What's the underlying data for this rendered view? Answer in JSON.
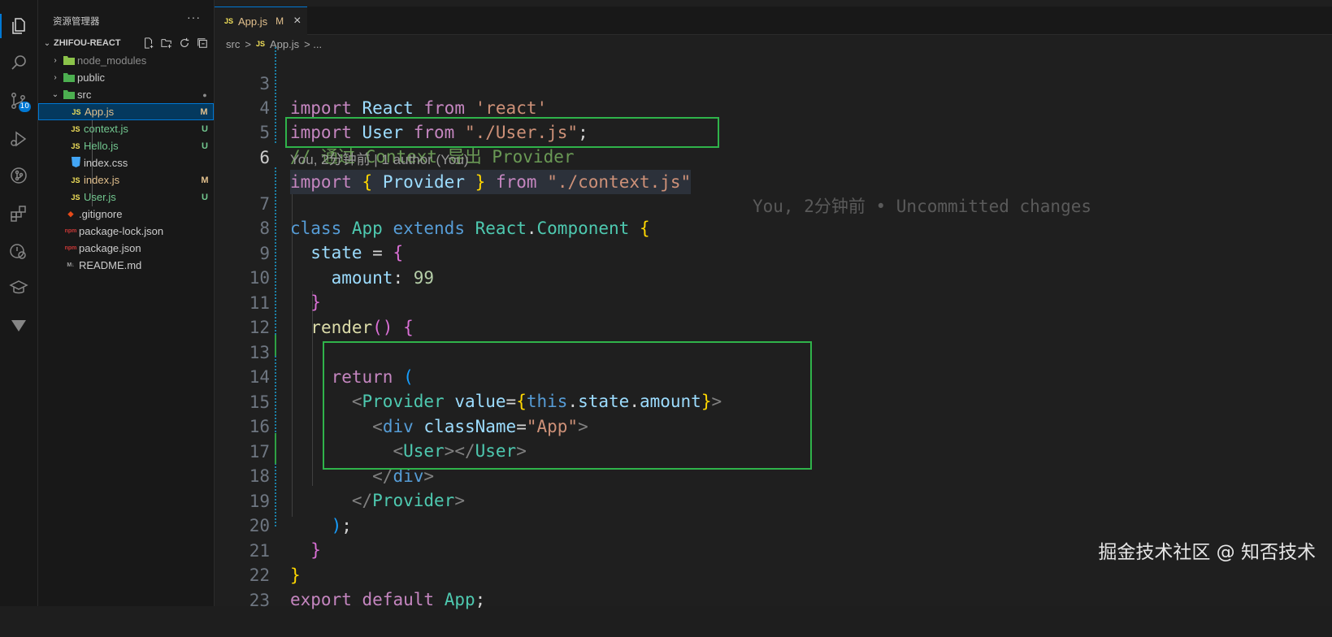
{
  "activity_bar": {
    "icons": [
      "files-icon",
      "search-icon",
      "source-control-icon",
      "run-debug-icon",
      "git-graph-icon",
      "extensions-icon",
      "remote-explorer-icon",
      "learn-icon",
      "tasks-icon"
    ],
    "source_control_badge": "10"
  },
  "sidebar": {
    "title": "资源管理器",
    "more": "···",
    "project": "ZHIFOU-REACT",
    "items": [
      {
        "label": "node_modules",
        "icon_text": "",
        "status": ""
      },
      {
        "label": "public",
        "icon_text": "",
        "status": ""
      },
      {
        "label": "src",
        "icon_text": "",
        "status": "●"
      },
      {
        "label": "App.js",
        "icon_text": "JS",
        "status": "M"
      },
      {
        "label": "context.js",
        "icon_text": "JS",
        "status": "U"
      },
      {
        "label": "Hello.js",
        "icon_text": "JS",
        "status": "U"
      },
      {
        "label": "index.css",
        "icon_text": "3",
        "status": ""
      },
      {
        "label": "index.js",
        "icon_text": "JS",
        "status": "M"
      },
      {
        "label": "User.js",
        "icon_text": "JS",
        "status": "U"
      },
      {
        "label": ".gitignore",
        "icon_text": "◆",
        "status": ""
      },
      {
        "label": "package-lock.json",
        "icon_text": "npm",
        "status": ""
      },
      {
        "label": "package.json",
        "icon_text": "npm",
        "status": ""
      },
      {
        "label": "README.md",
        "icon_text": "M↓",
        "status": ""
      }
    ]
  },
  "editor": {
    "tab": {
      "icon": "JS",
      "label": "App.js",
      "mark": "M",
      "close": "×"
    },
    "breadcrumb": {
      "folder": "src",
      "sep": ">",
      "file_icon": "JS",
      "file": "App.js",
      "tail": "> ..."
    },
    "line_numbers": [
      "3",
      "4",
      "5",
      "6",
      "7",
      "8",
      "9",
      "10",
      "11",
      "12",
      "13",
      "14",
      "15",
      "16",
      "17",
      "18",
      "19",
      "20",
      "21",
      "22",
      "23"
    ],
    "codelens": "You, 2分钟前 | 1 author (You)",
    "blame": "You, 2分钟前 • Uncommitted changes",
    "code": {
      "l3": [
        "import",
        "React",
        "from",
        "'react'"
      ],
      "l4": [
        "import",
        "User",
        "from",
        "\"./User.js\"",
        ";"
      ],
      "l5": "// 通过 Context 导出 Provider",
      "l6": [
        "import",
        "{",
        "Provider",
        "}",
        "from",
        "\"./context.js\""
      ],
      "l7": [
        "class",
        "App",
        "extends",
        "React",
        ".",
        "Component",
        "{"
      ],
      "l8": [
        "state",
        "=",
        "{"
      ],
      "l9": [
        "amount",
        ":",
        "99"
      ],
      "l10": [
        "}"
      ],
      "l11": [
        "render",
        "()",
        "{"
      ],
      "l13": [
        "return",
        "("
      ],
      "l14": [
        "<",
        "Provider",
        "value",
        "=",
        "{",
        "this",
        ".",
        "state",
        ".",
        "amount",
        "}",
        ">"
      ],
      "l15": [
        "<",
        "div",
        "className",
        "=",
        "\"App\"",
        ">"
      ],
      "l16": [
        "<",
        "User",
        "></",
        "User",
        ">"
      ],
      "l17": [
        "</",
        "div",
        ">"
      ],
      "l18": [
        "</",
        "Provider",
        ">"
      ],
      "l19": [
        ")",
        ";"
      ],
      "l20": [
        "}"
      ],
      "l21": [
        "}"
      ],
      "l22": [
        "export",
        "default",
        "App",
        ";"
      ]
    }
  },
  "watermark": "掘金技术社区 @ 知否技术"
}
